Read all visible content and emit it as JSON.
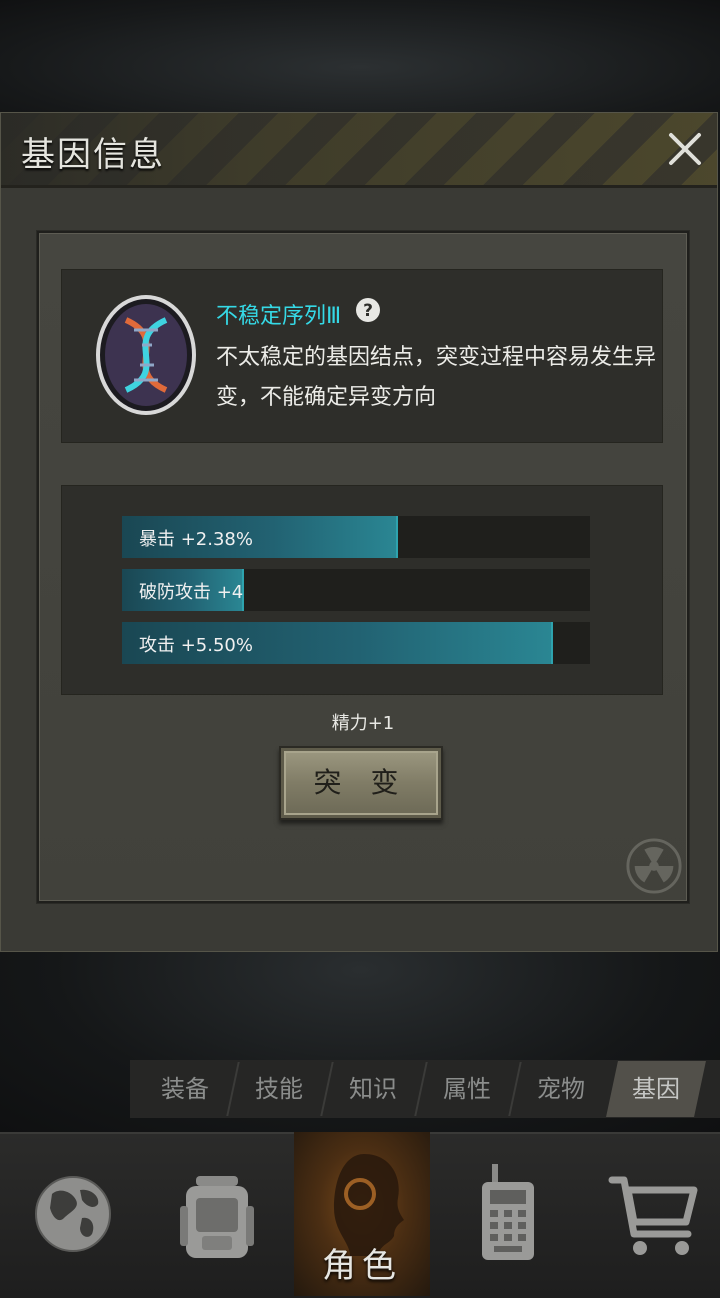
{
  "popup": {
    "title": "基因信息"
  },
  "gene": {
    "name": "不稳定序列Ⅲ",
    "description": "不太稳定的基因结点，突变过程中容易发生异变，不能确定异变方向"
  },
  "stats": [
    {
      "label": "暴击 +2.38%",
      "fill": 0.59
    },
    {
      "label": "破防攻击 +4",
      "fill": 0.26
    },
    {
      "label": "攻击 +5.50%",
      "fill": 0.92
    }
  ],
  "energy": "精力+1",
  "mutate_button": "突 变",
  "tabs": [
    {
      "label": "装备"
    },
    {
      "label": "技能"
    },
    {
      "label": "知识"
    },
    {
      "label": "属性"
    },
    {
      "label": "宠物"
    },
    {
      "label": "基因",
      "active": true
    }
  ],
  "nav": {
    "active_label": "角色",
    "items": [
      "globe-icon",
      "backpack-icon",
      "character-icon",
      "walkie-talkie-icon",
      "shopping-cart-icon"
    ]
  },
  "colors": {
    "gene_name": "#35d9e6",
    "bar_fill": "#2a8693",
    "active_nav": "#7a4a1a"
  }
}
